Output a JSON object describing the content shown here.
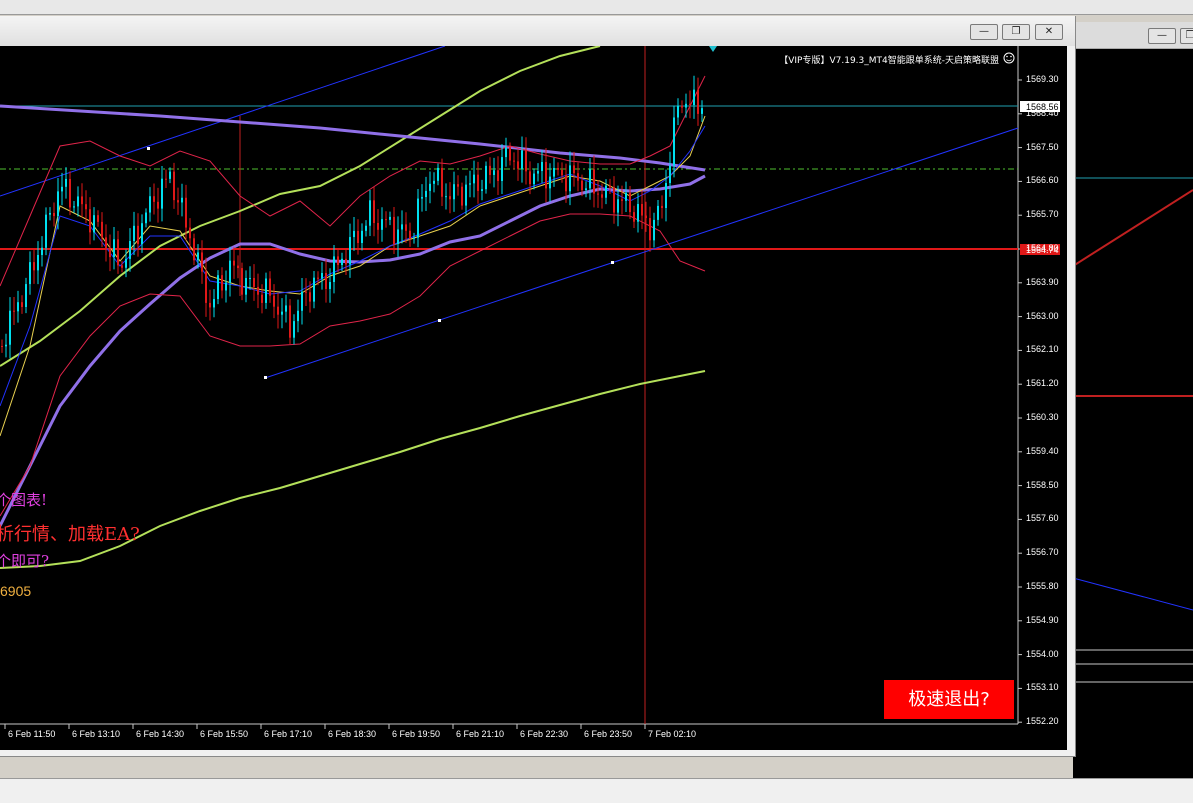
{
  "window": {
    "minimize_glyph": "—",
    "restore_glyph": "❐",
    "close_glyph": "✕"
  },
  "chart_data": {
    "type": "line",
    "title": "【VIP专版】V7.19.3_MT4智能跟单系统-天启策略联盟",
    "y_ticks": [
      "1569.30",
      "1568.40",
      "1567.50",
      "1566.60",
      "1565.70",
      "1564.80",
      "1563.90",
      "1563.00",
      "1562.10",
      "1561.20",
      "1560.30",
      "1559.40",
      "1558.50",
      "1557.60",
      "1556.70",
      "1555.80",
      "1554.90",
      "1554.00",
      "1553.10",
      "1552.20"
    ],
    "x_ticks": [
      "6 Feb 11:50",
      "6 Feb 13:10",
      "6 Feb 14:30",
      "6 Feb 15:50",
      "6 Feb 17:10",
      "6 Feb 18:30",
      "6 Feb 19:50",
      "6 Feb 21:10",
      "6 Feb 22:30",
      "6 Feb 23:50",
      "7 Feb 02:10"
    ],
    "ylim": [
      1552.2,
      1569.8
    ],
    "current_price": "1568.56",
    "current_price_value": 1568.56,
    "level_price": "1564.74",
    "level_price_value": 1564.74,
    "grid": false,
    "background": "#000000",
    "colors": {
      "bull": "#00e0f0",
      "bear": "#e01818",
      "bands": "#e0244a",
      "slow_ma": "#9070e8",
      "long_ma": "#b4e05a",
      "overlay_magenta": "#e040e0",
      "overlay_red": "#ff3030",
      "overlay_orange": "#f0b040",
      "trend_blue": "#2233ff",
      "hline_cyan": "#20a0b0",
      "hline_dashed": "#50c030"
    }
  },
  "overlay": {
    "line1": "个图表!",
    "line2": "析行情、加载EA?",
    "line3": "个即可?",
    "line4": "6905"
  },
  "exit_button": "极速退出?"
}
